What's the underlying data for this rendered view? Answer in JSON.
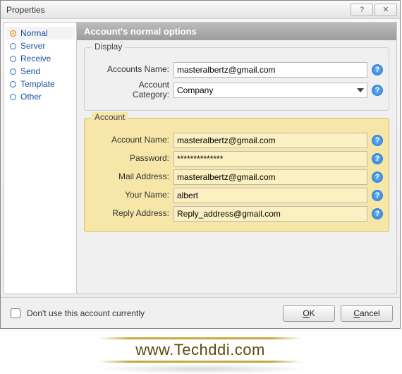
{
  "window": {
    "title": "Properties"
  },
  "sidebar": {
    "items": [
      {
        "label": "Normal",
        "active": true
      },
      {
        "label": "Server"
      },
      {
        "label": "Receive"
      },
      {
        "label": "Send"
      },
      {
        "label": "Template"
      },
      {
        "label": "Other"
      }
    ]
  },
  "header": {
    "title": "Account's normal options"
  },
  "display_group": {
    "legend": "Display",
    "accounts_name_label": "Accounts Name:",
    "accounts_name_value": "masteralbertz@gmail.com",
    "category_label_line1": "Account",
    "category_label_line2": "Category:",
    "category_value": "Company"
  },
  "account_group": {
    "legend": "Account",
    "account_name_label": "Account Name:",
    "account_name_value": "masteralbertz@gmail.com",
    "password_label": "Password:",
    "password_value": "**************",
    "mail_label": "Mail Address:",
    "mail_value": "masteralbertz@gmail.com",
    "your_name_label": "Your Name:",
    "your_name_value": "albert",
    "reply_label": "Reply Address:",
    "reply_value": "Reply_address@gmail.com"
  },
  "footer": {
    "checkbox_label": "Don't use this account currently",
    "ok": "OK",
    "cancel": "Cancel"
  },
  "watermark": "www.Techddi.com"
}
